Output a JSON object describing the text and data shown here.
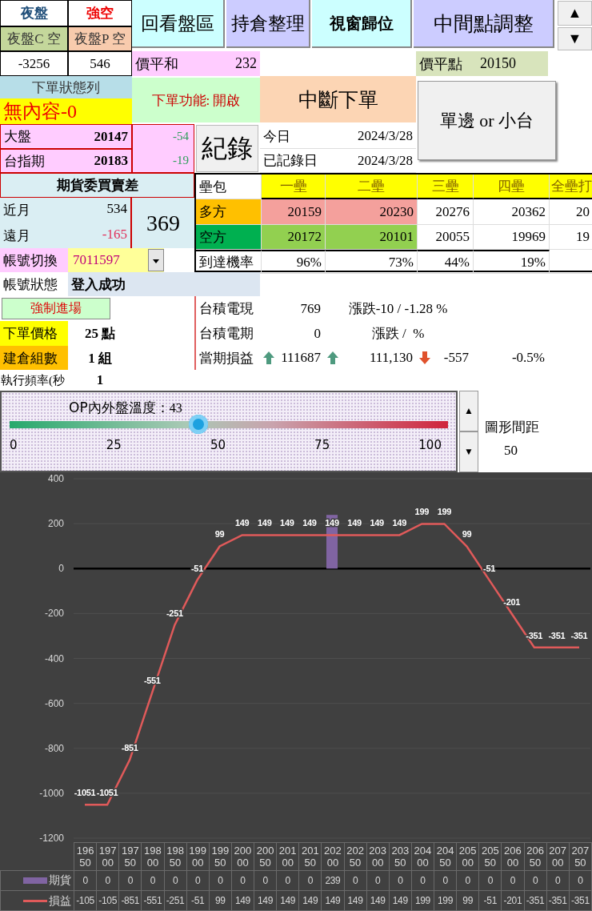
{
  "night_session": {
    "title": "夜盤",
    "signal": "強空",
    "call_label": "夜盤C 空",
    "put_label": "夜盤P 空",
    "call_value": "-3256",
    "put_value": "546"
  },
  "top_buttons": [
    {
      "label": "回看盤區"
    },
    {
      "label": "持倉整理"
    },
    {
      "label": "視窗歸位"
    },
    {
      "label": "中間點調整"
    }
  ],
  "scroll_arrows": [
    "▲",
    "▼"
  ],
  "atm_sum": {
    "label": "價平和",
    "value": "232"
  },
  "atm_strike": {
    "label": "價平點",
    "value": "20150"
  },
  "order_status": {
    "title": "下單狀態列",
    "message": "無內容-0"
  },
  "order_function": "下單功能: 開啟",
  "stop_order_button": "中斷下單",
  "mode_button": "單邊 or 小台",
  "index": [
    {
      "label": "大盤",
      "value": "20147",
      "change": "-54"
    },
    {
      "label": "台指期",
      "value": "20183",
      "change": "-19"
    }
  ],
  "record_button": "紀錄",
  "dates": [
    {
      "label": "今日",
      "value": "2024/3/28"
    },
    {
      "label": "已記錄日",
      "value": "2024/3/28"
    }
  ],
  "bid_ask_diff": {
    "title": "期貨委買賣差",
    "rows": [
      {
        "label": "近月",
        "value": "534",
        "negative": false
      },
      {
        "label": "遠月",
        "value": "-165",
        "negative": true
      }
    ],
    "total": "369"
  },
  "bases": {
    "header": "壘包",
    "columns": [
      "一壘",
      "二壘",
      "三壘",
      "四壘",
      "全壘打"
    ],
    "rows": [
      {
        "label": "多方",
        "kind": "long",
        "cells": [
          {
            "value": "20159",
            "highlighted": true
          },
          {
            "value": "20230",
            "highlighted": true
          },
          {
            "value": "20276",
            "highlighted": false
          },
          {
            "value": "20362",
            "highlighted": false
          },
          {
            "value": "20",
            "highlighted": false
          }
        ]
      },
      {
        "label": "空方",
        "kind": "short",
        "cells": [
          {
            "value": "20172",
            "highlighted": true
          },
          {
            "value": "20101",
            "highlighted": true
          },
          {
            "value": "20055",
            "highlighted": false
          },
          {
            "value": "19969",
            "highlighted": false
          },
          {
            "value": "19",
            "highlighted": false
          }
        ]
      },
      {
        "label": "到達機率",
        "kind": "probability",
        "cells": [
          {
            "value": "96%",
            "highlighted": false
          },
          {
            "value": "73%",
            "highlighted": false
          },
          {
            "value": "44%",
            "highlighted": false
          },
          {
            "value": "19%",
            "highlighted": false
          }
        ]
      }
    ]
  },
  "account": {
    "label": "帳號切換",
    "value": "7011597",
    "status_label": "帳號狀態",
    "status": "登入成功"
  },
  "force_entry_button": "強制進場",
  "settings": [
    {
      "label": "下單價格",
      "value": "25 點"
    },
    {
      "label": "建倉組數",
      "value": "1 組"
    },
    {
      "label": "執行頻率(秒",
      "value": "1"
    }
  ],
  "tsmc": [
    {
      "label": "台積電現",
      "value": "769",
      "change": "漲跌-10 / -1.28 %"
    },
    {
      "label": "台積電期",
      "value": "0",
      "change": "漲跌 /  %"
    }
  ],
  "pnl": {
    "label": "當期損益",
    "cells": [
      {
        "value": "111687",
        "kind": "up"
      },
      {
        "value": "111,130",
        "kind": "up"
      },
      {
        "value": "-557",
        "kind": "down"
      },
      {
        "value": "-0.5%",
        "kind": "plain"
      }
    ]
  },
  "temperature": {
    "title": "OP內外盤溫度：",
    "reading": "43",
    "level": 0.43,
    "ticks": [
      "0",
      "25",
      "50",
      "75",
      "100"
    ]
  },
  "spin_arrows": [
    "▲",
    "▼"
  ],
  "chart_spacing": {
    "label": "圖形間距",
    "value": "50"
  },
  "chart": {
    "chart_data": {
      "type": "line",
      "categories": [
        "19650",
        "19700",
        "19750",
        "19800",
        "19850",
        "19900",
        "19950",
        "20000",
        "20050",
        "20100",
        "20150",
        "20200",
        "20250",
        "20300",
        "20350",
        "20400",
        "20450",
        "20500",
        "20550",
        "20600",
        "20650",
        "20700",
        "20750"
      ],
      "series": [
        {
          "name": "期貨",
          "type": "bar",
          "color": "#8064a2",
          "values": [
            0,
            0,
            0,
            0,
            0,
            0,
            0,
            0,
            0,
            0,
            0,
            239,
            0,
            0,
            0,
            0,
            0,
            0,
            0,
            0,
            0,
            0,
            0
          ]
        },
        {
          "name": "損益",
          "color": "#e05a5a",
          "values": [
            -1051,
            -1051,
            -851,
            -551,
            -251,
            -51,
            99,
            149,
            149,
            149,
            149,
            149,
            149,
            149,
            149,
            199,
            199,
            99,
            -51,
            -201,
            -351,
            -351,
            -351
          ]
        }
      ],
      "ylim": [
        -1200,
        400
      ],
      "yticks": [
        -1200,
        -1000,
        -800,
        -600,
        -400,
        -200,
        0,
        200,
        400
      ],
      "data_labels": true,
      "grid": true,
      "legend": true
    },
    "table_rows": [
      [
        "0",
        "0",
        "0",
        "0",
        "0",
        "0",
        "0",
        "0",
        "0",
        "0",
        "0",
        "239",
        "0",
        "0",
        "0",
        "0",
        "0",
        "0",
        "0",
        "0",
        "0",
        "0",
        "0"
      ],
      [
        "-105",
        "-105",
        "-851",
        "-551",
        "-251",
        "-51",
        "99",
        "149",
        "149",
        "149",
        "149",
        "149",
        "149",
        "149",
        "149",
        "199",
        "199",
        "99",
        "-51",
        "-201",
        "-351",
        "-351",
        "-351"
      ]
    ]
  }
}
